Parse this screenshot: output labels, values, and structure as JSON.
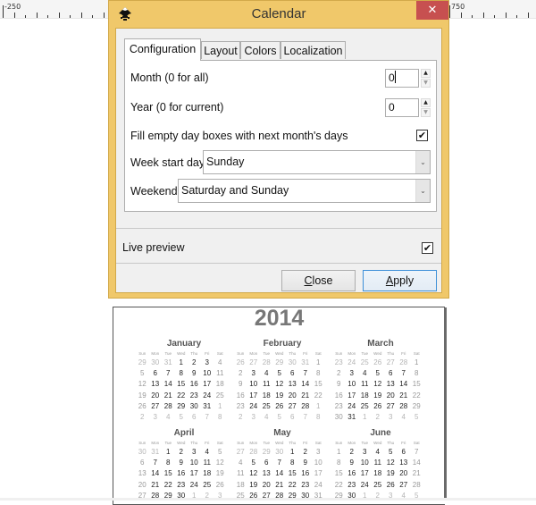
{
  "ruler": {
    "left_label": "-250",
    "right_label": "750"
  },
  "dialog": {
    "title": "Calendar",
    "app_icon": "inkscape-logo-icon",
    "close_glyph": "✕",
    "tabs": [
      {
        "label": "Configuration",
        "active": true
      },
      {
        "label": "Layout",
        "active": false
      },
      {
        "label": "Colors",
        "active": false
      },
      {
        "label": "Localization",
        "active": false
      }
    ],
    "month_label": "Month (0 for all)",
    "month_value": "0",
    "year_label": "Year (0 for current)",
    "year_value": "0",
    "fill_label": "Fill empty day boxes with next month's days",
    "fill_checked": true,
    "week_start_label": "Week start day",
    "week_start_value": "Sunday",
    "weekend_label": "Weekend",
    "weekend_value": "Saturday and Sunday",
    "live_preview_label": "Live preview",
    "live_preview_checked": true,
    "close_button": {
      "mnemonic": "C",
      "rest": "lose"
    },
    "apply_button": {
      "mnemonic": "A",
      "rest": "pply"
    },
    "check_glyph": "✔",
    "up_glyph": "▲",
    "down_glyph": "▼",
    "combo_arrow_glyph": "⌄"
  },
  "calendar": {
    "year": "2014",
    "weekdays": [
      "Sun",
      "Mon",
      "Tue",
      "Wed",
      "Thu",
      "Fri",
      "Sat"
    ],
    "months": [
      {
        "name": "January",
        "weeks": [
          [
            29,
            30,
            31,
            1,
            2,
            3,
            4
          ],
          [
            5,
            6,
            7,
            8,
            9,
            10,
            11
          ],
          [
            12,
            13,
            14,
            15,
            16,
            17,
            18
          ],
          [
            19,
            20,
            21,
            22,
            23,
            24,
            25
          ],
          [
            26,
            27,
            28,
            29,
            30,
            31,
            1
          ],
          [
            2,
            3,
            4,
            5,
            6,
            7,
            8
          ]
        ]
      },
      {
        "name": "February",
        "weeks": [
          [
            26,
            27,
            28,
            29,
            30,
            31,
            1
          ],
          [
            2,
            3,
            4,
            5,
            6,
            7,
            8
          ],
          [
            9,
            10,
            11,
            12,
            13,
            14,
            15
          ],
          [
            16,
            17,
            18,
            19,
            20,
            21,
            22
          ],
          [
            23,
            24,
            25,
            26,
            27,
            28,
            1
          ],
          [
            2,
            3,
            4,
            5,
            6,
            7,
            8
          ]
        ]
      },
      {
        "name": "March",
        "weeks": [
          [
            23,
            24,
            25,
            26,
            27,
            28,
            1
          ],
          [
            2,
            3,
            4,
            5,
            6,
            7,
            8
          ],
          [
            9,
            10,
            11,
            12,
            13,
            14,
            15
          ],
          [
            16,
            17,
            18,
            19,
            20,
            21,
            22
          ],
          [
            23,
            24,
            25,
            26,
            27,
            28,
            29
          ],
          [
            30,
            31,
            1,
            2,
            3,
            4,
            5
          ]
        ]
      },
      {
        "name": "April",
        "weeks": [
          [
            30,
            31,
            1,
            2,
            3,
            4,
            5
          ],
          [
            6,
            7,
            8,
            9,
            10,
            11,
            12
          ],
          [
            13,
            14,
            15,
            16,
            17,
            18,
            19
          ],
          [
            20,
            21,
            22,
            23,
            24,
            25,
            26
          ],
          [
            27,
            28,
            29,
            30,
            1,
            2,
            3
          ]
        ]
      },
      {
        "name": "May",
        "weeks": [
          [
            27,
            28,
            29,
            30,
            1,
            2,
            3
          ],
          [
            4,
            5,
            6,
            7,
            8,
            9,
            10
          ],
          [
            11,
            12,
            13,
            14,
            15,
            16,
            17
          ],
          [
            18,
            19,
            20,
            21,
            22,
            23,
            24
          ],
          [
            25,
            26,
            27,
            28,
            29,
            30,
            31
          ]
        ]
      },
      {
        "name": "June",
        "weeks": [
          [
            1,
            2,
            3,
            4,
            5,
            6,
            7
          ],
          [
            8,
            9,
            10,
            11,
            12,
            13,
            14
          ],
          [
            15,
            16,
            17,
            18,
            19,
            20,
            21
          ],
          [
            22,
            23,
            24,
            25,
            26,
            27,
            28
          ],
          [
            29,
            30,
            1,
            2,
            3,
            4,
            5
          ]
        ]
      }
    ]
  }
}
